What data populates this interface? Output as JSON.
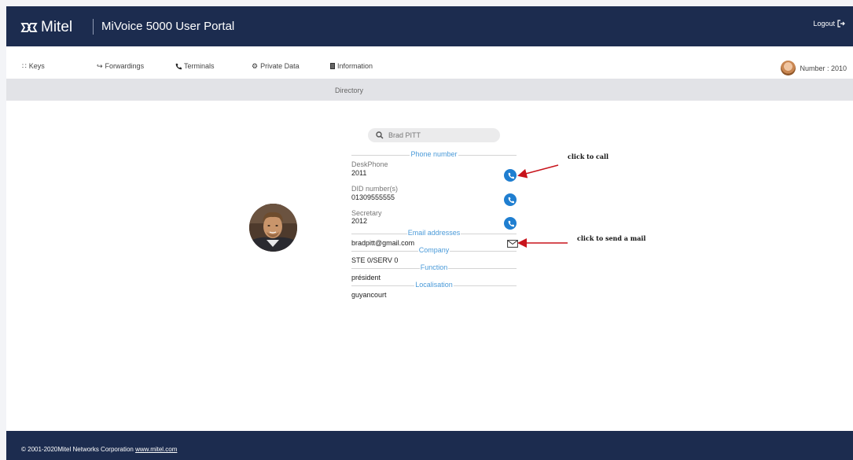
{
  "header": {
    "brand": "Mitel",
    "app_title": "MiVoice 5000 User Portal",
    "logout_label": "Logout"
  },
  "nav": {
    "items": [
      {
        "label": "Keys",
        "icon": "keypad-icon"
      },
      {
        "label": "Forwardings",
        "icon": "forward-arrow-icon"
      },
      {
        "label": "Terminals",
        "icon": "phone-icon"
      },
      {
        "label": "Private Data",
        "icon": "gear-icon"
      },
      {
        "label": "Information",
        "icon": "document-icon"
      }
    ],
    "user_number": "Number : 2010"
  },
  "subbar": {
    "label": "Directory"
  },
  "search": {
    "value": "Brad PITT"
  },
  "contact": {
    "sections": {
      "phone": "Phone number",
      "email": "Email addresses",
      "company": "Company",
      "function": "Function",
      "localisation": "Localisation"
    },
    "deskphone_label": "DeskPhone",
    "deskphone_value": "2011",
    "did_label": "DID number(s)",
    "did_value": "01309555555",
    "secretary_label": "Secretary",
    "secretary_value": "2012",
    "email_value": "bradpitt@gmail.com",
    "company_value": "STE 0/SERV 0",
    "function_value": "président",
    "localisation_value": "guyancourt"
  },
  "annotations": {
    "call": "click to call",
    "mail": "click to send a mail"
  },
  "footer": {
    "copyright": "© 2001-2020Mitel Networks Corporation ",
    "link": "www.mitel.com"
  },
  "colors": {
    "header_bg": "#1c2c4f",
    "accent_blue": "#1f7ed0",
    "section_label": "#4a9ad8",
    "annotation_arrow": "#c8141c"
  }
}
